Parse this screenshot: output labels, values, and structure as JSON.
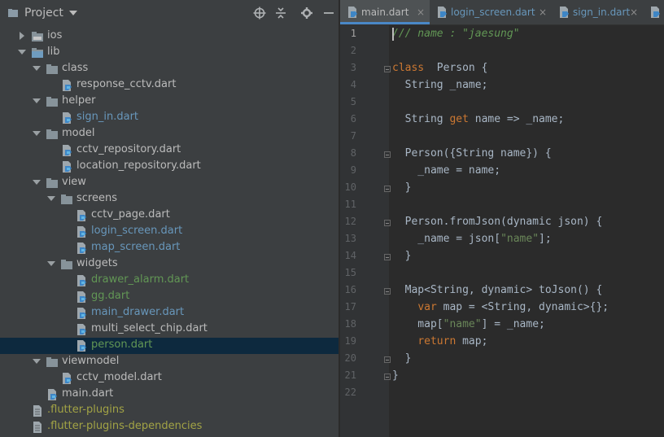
{
  "project_panel": {
    "title": "Project",
    "tree": [
      {
        "name": "ios",
        "type": "folder",
        "depth": 1,
        "expanded": false,
        "color": "#bbbbbb"
      },
      {
        "name": "lib",
        "type": "folder",
        "depth": 1,
        "expanded": true,
        "color": "#bbbbbb"
      },
      {
        "name": "class",
        "type": "folder",
        "depth": 2,
        "expanded": true,
        "color": "#bbbbbb"
      },
      {
        "name": "response_cctv.dart",
        "type": "dart",
        "depth": 3,
        "color": "#bbbbbb"
      },
      {
        "name": "helper",
        "type": "folder",
        "depth": 2,
        "expanded": true,
        "color": "#bbbbbb"
      },
      {
        "name": "sign_in.dart",
        "type": "dart",
        "depth": 3,
        "color": "#6897bb"
      },
      {
        "name": "model",
        "type": "folder",
        "depth": 2,
        "expanded": true,
        "color": "#bbbbbb"
      },
      {
        "name": "cctv_repository.dart",
        "type": "dart",
        "depth": 3,
        "color": "#bbbbbb"
      },
      {
        "name": "location_repository.dart",
        "type": "dart",
        "depth": 3,
        "color": "#bbbbbb"
      },
      {
        "name": "view",
        "type": "folder",
        "depth": 2,
        "expanded": true,
        "color": "#bbbbbb"
      },
      {
        "name": "screens",
        "type": "folder",
        "depth": 3,
        "expanded": true,
        "color": "#bbbbbb"
      },
      {
        "name": "cctv_page.dart",
        "type": "dart",
        "depth": 4,
        "color": "#bbbbbb"
      },
      {
        "name": "login_screen.dart",
        "type": "dart",
        "depth": 4,
        "color": "#6897bb"
      },
      {
        "name": "map_screen.dart",
        "type": "dart",
        "depth": 4,
        "color": "#6897bb"
      },
      {
        "name": "widgets",
        "type": "folder",
        "depth": 3,
        "expanded": true,
        "color": "#bbbbbb"
      },
      {
        "name": "drawer_alarm.dart",
        "type": "dart",
        "depth": 4,
        "color": "#629755"
      },
      {
        "name": "gg.dart",
        "type": "dart",
        "depth": 4,
        "color": "#629755"
      },
      {
        "name": "main_drawer.dart",
        "type": "dart",
        "depth": 4,
        "color": "#6897bb"
      },
      {
        "name": "multi_select_chip.dart",
        "type": "dart",
        "depth": 4,
        "color": "#bbbbbb"
      },
      {
        "name": "person.dart",
        "type": "dart",
        "depth": 4,
        "color": "#629755",
        "selected": true
      },
      {
        "name": "viewmodel",
        "type": "folder",
        "depth": 2,
        "expanded": true,
        "color": "#bbbbbb"
      },
      {
        "name": "cctv_model.dart",
        "type": "dart",
        "depth": 3,
        "color": "#bbbbbb"
      },
      {
        "name": "main.dart",
        "type": "dart",
        "depth": 2,
        "color": "#bbbbbb"
      },
      {
        "name": ".flutter-plugins",
        "type": "file",
        "depth": 1,
        "color": "#a2a345"
      },
      {
        "name": ".flutter-plugins-dependencies",
        "type": "file",
        "depth": 1,
        "color": "#a2a345"
      }
    ]
  },
  "tabs": [
    {
      "label": "main.dart",
      "color": "#bbbbbb",
      "active": true
    },
    {
      "label": "login_screen.dart",
      "color": "#6897bb",
      "active": false
    },
    {
      "label": "sign_in.dart",
      "color": "#6897bb",
      "active": false
    },
    {
      "label": "r",
      "color": "#6897bb",
      "active": false
    }
  ],
  "tab_close_glyph": "×",
  "editor": {
    "lines": [
      [
        [
          "cm",
          "/// name : \""
        ],
        [
          "cm",
          "jaesung"
        ],
        [
          "cm",
          "\""
        ]
      ],
      [],
      [
        [
          "kw",
          "class"
        ],
        [
          "",
          "  Person {"
        ]
      ],
      [
        [
          "",
          "  String _name;"
        ]
      ],
      [],
      [
        [
          "",
          "  String "
        ],
        [
          "kw",
          "get"
        ],
        [
          "",
          " name => _name;"
        ]
      ],
      [],
      [
        [
          "",
          "  Person({String name}) {"
        ]
      ],
      [
        [
          "",
          "    _name = name;"
        ]
      ],
      [
        [
          "",
          "  }"
        ]
      ],
      [],
      [
        [
          "",
          "  Person.fromJson(dynamic json) {"
        ]
      ],
      [
        [
          "",
          "    _name = json["
        ],
        [
          "str",
          "\"name\""
        ],
        [
          "",
          "];"
        ]
      ],
      [
        [
          "",
          "  }"
        ]
      ],
      [],
      [
        [
          "",
          "  Map<String, dynamic> toJson() {"
        ]
      ],
      [
        [
          "",
          "    "
        ],
        [
          "kw",
          "var"
        ],
        [
          "",
          " map = <String, dynamic>{};"
        ]
      ],
      [
        [
          "",
          "    map["
        ],
        [
          "str",
          "\"name\""
        ],
        [
          "",
          "] = _name;"
        ]
      ],
      [
        [
          "",
          "    "
        ],
        [
          "kw",
          "return"
        ],
        [
          "",
          " map;"
        ]
      ],
      [
        [
          "",
          "  }"
        ]
      ],
      [
        [
          "",
          "}"
        ]
      ],
      []
    ],
    "fold_lines": [
      3,
      8,
      10,
      12,
      14,
      16,
      20,
      21
    ]
  }
}
